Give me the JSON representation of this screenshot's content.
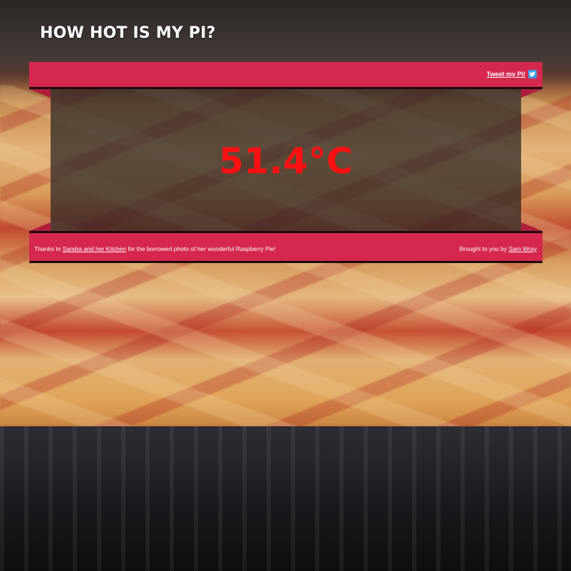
{
  "site": {
    "title": "HOW HOT IS MY PI?"
  },
  "header_ribbon": {
    "tweet_label": "Tweet my Pi!",
    "tweet_icon": "twitter-icon",
    "color": "#d6284e"
  },
  "temperature": {
    "value": "51.4°C",
    "color": "#ff1010"
  },
  "footer_ribbon": {
    "credits_prefix": "Thanks to ",
    "credits_link": "Sandra and her Kitchen",
    "credits_suffix": " for the borrowed photo of her wonderful Raspberry Pie!",
    "byline_prefix": "Brought to you by ",
    "byline_link": "Sam Wray"
  }
}
